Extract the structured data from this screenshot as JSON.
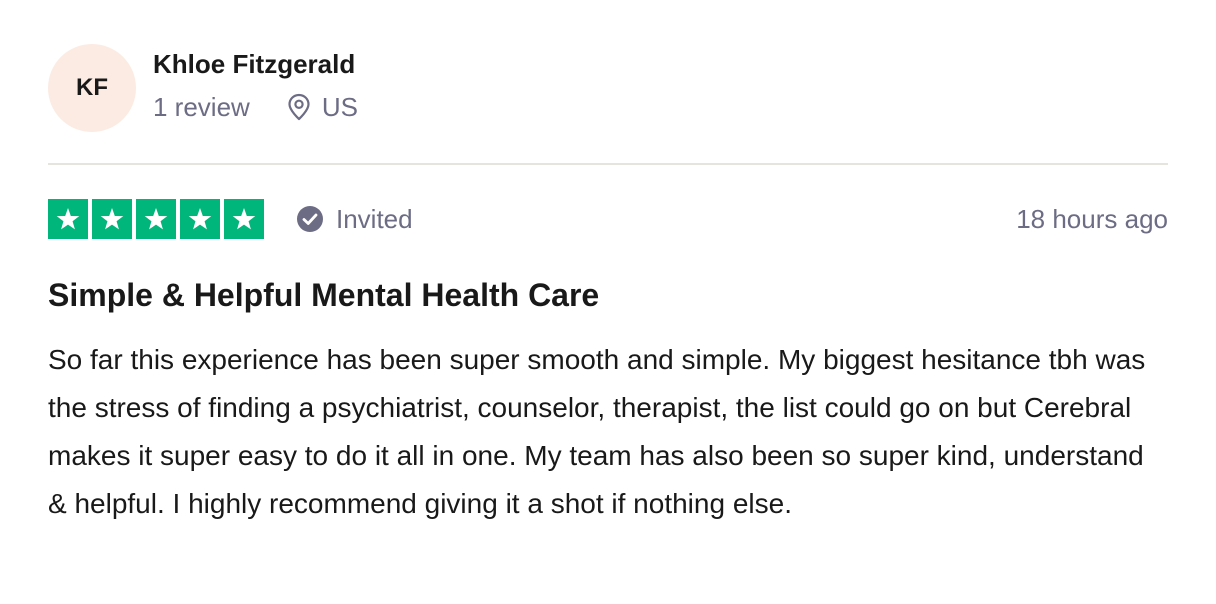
{
  "consumer": {
    "initials": "KF",
    "name": "Khloe Fitzgerald",
    "review_count": "1 review",
    "location": "US"
  },
  "review": {
    "rating": 5,
    "max_rating": 5,
    "verification_label": "Invited",
    "date": "18 hours ago",
    "title": "Simple & Helpful Mental Health Care",
    "body": "So far this experience has been super smooth and simple. My biggest hesitance tbh was the stress of finding a psychiatrist, counselor, therapist, the list could go on but Cerebral makes it super easy to do it all in one. My team has also been so super kind, understand & helpful. I highly recommend giving it a shot if nothing else."
  },
  "icons": {
    "location": "location-pin-icon",
    "verification": "check-circle-icon",
    "star": "star-icon"
  },
  "colors": {
    "star_background": "#00b67a",
    "avatar_background": "#fbebe3",
    "meta_text": "#6c6c85",
    "primary_text": "#191919",
    "divider": "#e5e5dd"
  }
}
